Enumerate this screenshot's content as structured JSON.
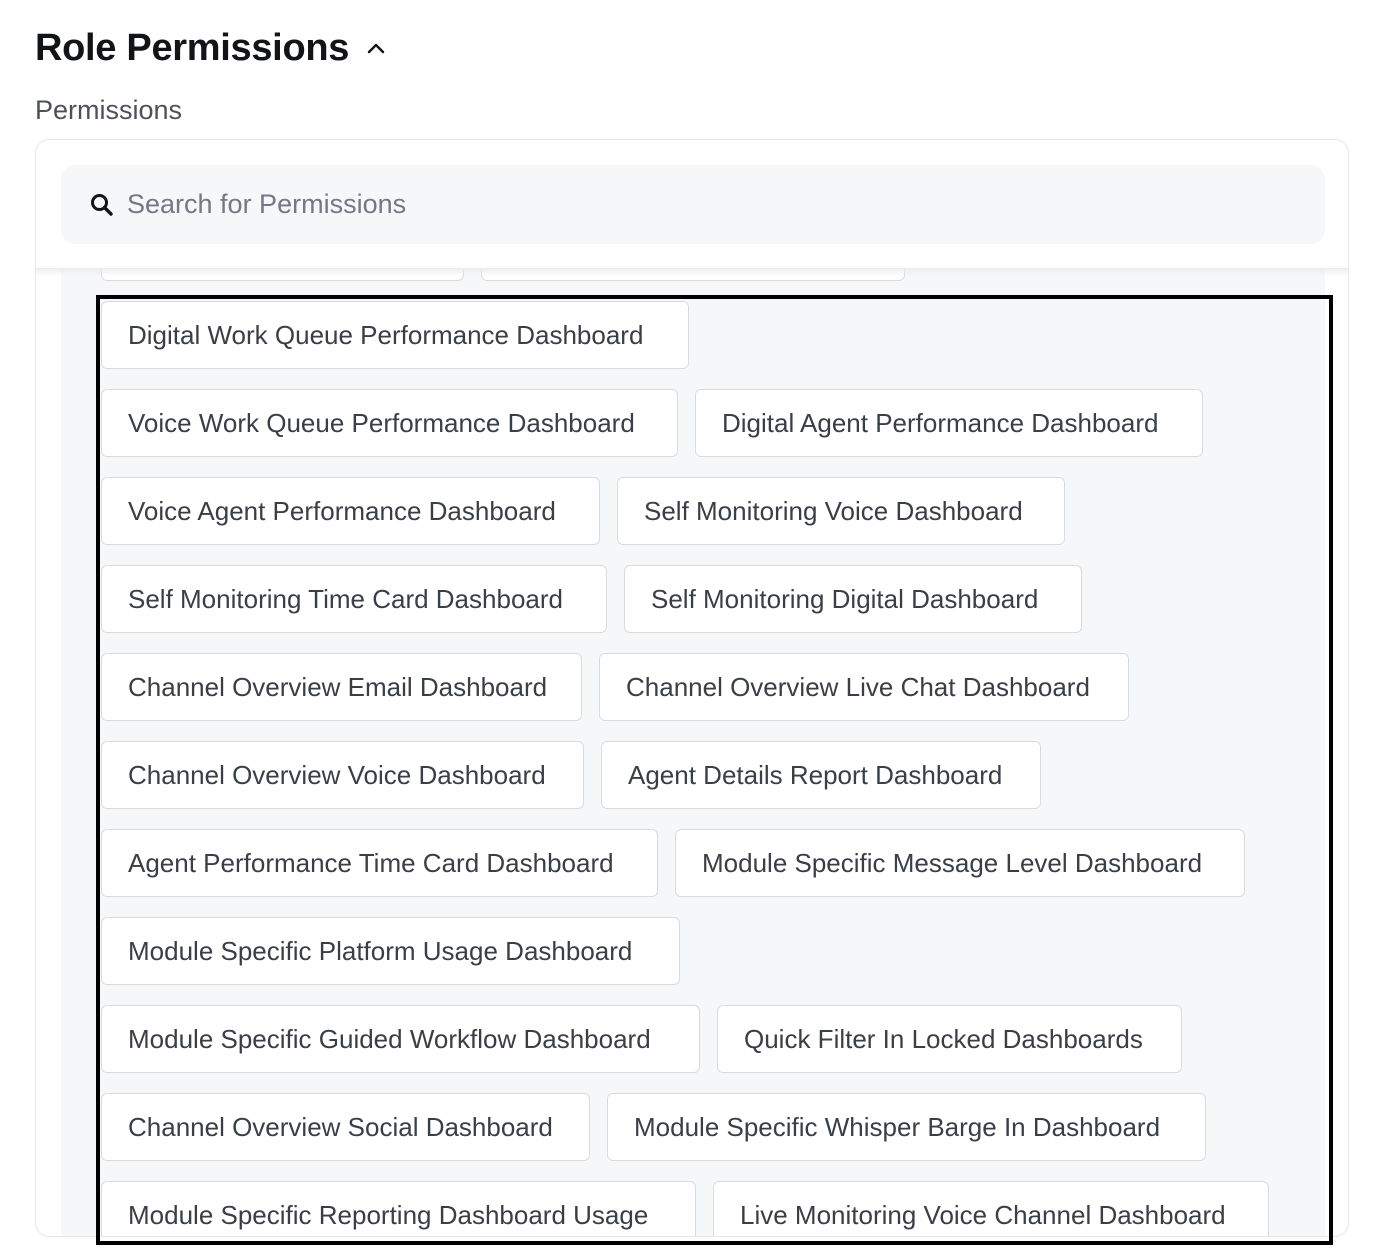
{
  "section": {
    "title": "Role Permissions",
    "expanded": true
  },
  "permissions": {
    "label": "Permissions",
    "search": {
      "placeholder": "Search for Permissions",
      "value": ""
    },
    "chips": [
      {
        "label": ""
      },
      {
        "label": ""
      },
      {
        "label": "Digital Work Queue Performance Dashboard"
      },
      {
        "label": "Voice Work Queue Performance Dashboard"
      },
      {
        "label": "Digital Agent Performance Dashboard"
      },
      {
        "label": "Voice Agent Performance Dashboard"
      },
      {
        "label": "Self Monitoring Voice Dashboard"
      },
      {
        "label": "Self Monitoring Time Card Dashboard"
      },
      {
        "label": "Self Monitoring Digital Dashboard"
      },
      {
        "label": "Channel Overview Email Dashboard"
      },
      {
        "label": "Channel Overview Live Chat Dashboard"
      },
      {
        "label": "Channel Overview Voice Dashboard"
      },
      {
        "label": "Agent Details Report Dashboard"
      },
      {
        "label": "Agent Performance Time Card Dashboard"
      },
      {
        "label": "Module Specific Message Level Dashboard"
      },
      {
        "label": "Module Specific Platform Usage Dashboard"
      },
      {
        "label": "Module Specific Guided Workflow Dashboard"
      },
      {
        "label": "Quick Filter In Locked Dashboards"
      },
      {
        "label": "Channel Overview Social Dashboard"
      },
      {
        "label": "Module Specific Whisper Barge In Dashboard"
      },
      {
        "label": "Module Specific Reporting Dashboard Usage"
      },
      {
        "label": "Live Monitoring Voice Channel Dashboard"
      }
    ]
  },
  "colors": {
    "chip_border": "#d9dbe0",
    "list_background": "#f6f7f9",
    "highlight_border": "#000000"
  },
  "icons": {
    "section_toggle": "chevron-up-icon",
    "search": "search-icon"
  }
}
